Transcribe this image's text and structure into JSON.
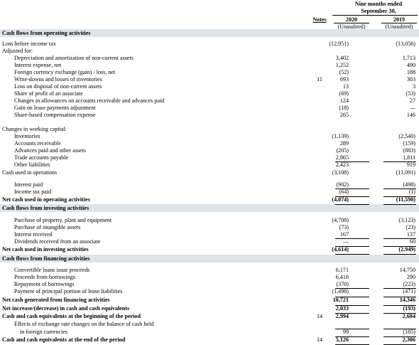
{
  "header": {
    "period_line1": "Nine months ended",
    "period_line2": "September 30,",
    "notes": "Notes",
    "year_2020": "2020",
    "year_2019": "2019",
    "unaudited_2020": "(Unaudited)",
    "unaudited_2019": "(Unaudited)"
  },
  "rows": [
    {
      "label": "Cash flows from operating activities",
      "style": "section",
      "notes": "",
      "v2020": "",
      "v2019": ""
    },
    {
      "label": "Loss before income tax",
      "style": "plain",
      "notes": "",
      "v2020": "(12,951)",
      "v2019": "(13,056)"
    },
    {
      "label": "Adjusted for:",
      "style": "plain",
      "notes": "",
      "v2020": "",
      "v2019": ""
    },
    {
      "label": "Depreciation and amortization of non-current assets",
      "style": "ind",
      "notes": "",
      "v2020": "3,402",
      "v2019": "1,713"
    },
    {
      "label": "Interest expense, net",
      "style": "ind",
      "notes": "",
      "v2020": "1,252",
      "v2019": "490"
    },
    {
      "label": "Foreign currency exchange (gain) / loss, net",
      "style": "ind",
      "notes": "",
      "v2020": "(52)",
      "v2019": "188"
    },
    {
      "label": "Write-downs and losses of inventories",
      "style": "ind",
      "notes": "11",
      "v2020": "693",
      "v2019": "303"
    },
    {
      "label": "Loss on disposal of non-current assets",
      "style": "ind",
      "notes": "",
      "v2020": "13",
      "v2019": "3"
    },
    {
      "label": "Share of profit of an associate",
      "style": "ind",
      "notes": "",
      "v2020": "(69)",
      "v2019": "(53)"
    },
    {
      "label": "Changes in allowances on accounts receivable and advances paid",
      "style": "ind",
      "notes": "",
      "v2020": "124",
      "v2019": "27"
    },
    {
      "label": "Gain on lease payments adjustment",
      "style": "ind",
      "notes": "",
      "v2020": "(18)",
      "v2019": "—"
    },
    {
      "label": "Share-based compensation expense",
      "style": "ind",
      "notes": "",
      "v2020": "265",
      "v2019": "146"
    },
    {
      "label": "Changes in working capital:",
      "style": "plain",
      "notes": "",
      "v2020": "",
      "v2019": ""
    },
    {
      "label": "Inventories",
      "style": "ind",
      "notes": "",
      "v2020": "(1,139)",
      "v2019": "(2,540)"
    },
    {
      "label": "Accounts receivable",
      "style": "ind",
      "notes": "",
      "v2020": "289",
      "v2019": "(159)"
    },
    {
      "label": "Advances paid and other assets",
      "style": "ind",
      "notes": "",
      "v2020": "(205)",
      "v2019": "(883)"
    },
    {
      "label": "Trade accounts payable",
      "style": "ind",
      "notes": "",
      "v2020": "2,865",
      "v2019": "1,811"
    },
    {
      "label": "Other liabilities",
      "style": "ind",
      "notes": "",
      "v2020": "2,423",
      "v2019": "919"
    },
    {
      "label": "Cash used in operations",
      "style": "plain",
      "notes": "",
      "v2020": "(3,108)",
      "v2019": "(11,091)"
    },
    {
      "label": "Interest paid",
      "style": "ind",
      "notes": "",
      "v2020": "(902)",
      "v2019": "(498)"
    },
    {
      "label": "Income tax paid",
      "style": "ind",
      "notes": "",
      "v2020": "(64)",
      "v2019": "(1)"
    },
    {
      "label": "Net cash used in operating activities",
      "style": "bold",
      "notes": "",
      "v2020": "(4,074)",
      "v2019": "(11,590)"
    },
    {
      "label": "Cash flows from investing activities",
      "style": "section",
      "notes": "",
      "v2020": "",
      "v2019": ""
    },
    {
      "label": "Purchase of property, plant and equipment",
      "style": "ind",
      "notes": "",
      "v2020": "(4,708)",
      "v2019": "(3,123)"
    },
    {
      "label": "Purchase of intangible assets",
      "style": "ind",
      "notes": "",
      "v2020": "(73)",
      "v2019": "(23)"
    },
    {
      "label": "Interest received",
      "style": "ind",
      "notes": "",
      "v2020": "167",
      "v2019": "137"
    },
    {
      "label": "Dividends received from an associate",
      "style": "ind",
      "notes": "",
      "v2020": "—",
      "v2019": "60"
    },
    {
      "label": "Net cash used in investing activities",
      "style": "bold",
      "notes": "",
      "v2020": "(4,614)",
      "v2019": "(2,949)"
    },
    {
      "label": "Cash flows from financing activities",
      "style": "section",
      "notes": "",
      "v2020": "",
      "v2019": ""
    },
    {
      "label": "Convertible loans issue proceeds",
      "style": "ind",
      "notes": "",
      "v2020": "6,171",
      "v2019": "14,750"
    },
    {
      "label": "Proceeds from borrowings",
      "style": "ind",
      "notes": "",
      "v2020": "6,418",
      "v2019": "290"
    },
    {
      "label": "Repayment of borrowings",
      "style": "ind",
      "notes": "",
      "v2020": "(370)",
      "v2019": "(223)"
    },
    {
      "label": "Payment of principal portion of lease liabilities",
      "style": "ind",
      "notes": "",
      "v2020": "(1,498)",
      "v2019": "(471)"
    },
    {
      "label": "Net cash generated from financing activities",
      "style": "bold",
      "notes": "",
      "v2020": "10,721",
      "v2019": "14,346"
    },
    {
      "label": "Net increase/(decrease) in cash and cash equivalents",
      "style": "bold",
      "notes": "",
      "v2020": "2,033",
      "v2019": "(193)"
    },
    {
      "label": "Cash and cash equivalents at the beginning of the period",
      "style": "bold",
      "notes": "14",
      "v2020": "2,994",
      "v2019": "2,684"
    },
    {
      "label": "Effects of exchange rate changes on the balance of cash held",
      "style": "ind",
      "notes": "",
      "v2020": "",
      "v2019": ""
    },
    {
      "label": "in foreign currencies",
      "style": "ind2",
      "notes": "",
      "v2020": "99",
      "v2019": "(185)"
    },
    {
      "label": "Cash and cash equivalents at the end of the period",
      "style": "bold",
      "notes": "14",
      "v2020": "5,126",
      "v2019": "2,306"
    }
  ]
}
